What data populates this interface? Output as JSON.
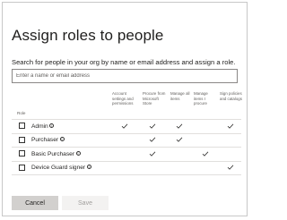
{
  "dialog": {
    "title": "Assign roles to people",
    "description": "Search for people in your org by name or email address and assign a role.",
    "search": {
      "placeholder": "Enter a name or email address",
      "value": ""
    }
  },
  "table": {
    "role_header": "Role",
    "columns": [
      "Account settings and permissions",
      "Procure from Microsoft Store",
      "Manage all items",
      "Manage items I procure",
      "Sign policies and catalogs"
    ],
    "rows": [
      {
        "name": "Admin",
        "checked": false,
        "info_icon": "info-icon",
        "permissions": [
          true,
          true,
          true,
          false,
          true
        ]
      },
      {
        "name": "Purchaser",
        "checked": false,
        "info_icon": "info-icon",
        "permissions": [
          false,
          true,
          true,
          false,
          false
        ]
      },
      {
        "name": "Basic Purchaser",
        "checked": false,
        "info_icon": "info-icon",
        "permissions": [
          false,
          true,
          false,
          true,
          false
        ]
      },
      {
        "name": "Device Guard signer",
        "checked": false,
        "info_icon": "info-icon",
        "permissions": [
          false,
          false,
          false,
          false,
          true
        ]
      }
    ]
  },
  "footer": {
    "cancel_label": "Cancel",
    "save_label": "Save"
  },
  "colors": {
    "check": "#323130",
    "cancel_bg": "#d2d0ce",
    "save_bg_disabled": "#f3f2f1",
    "save_text_disabled": "#a19f9d",
    "border": "#c8c8c8"
  }
}
